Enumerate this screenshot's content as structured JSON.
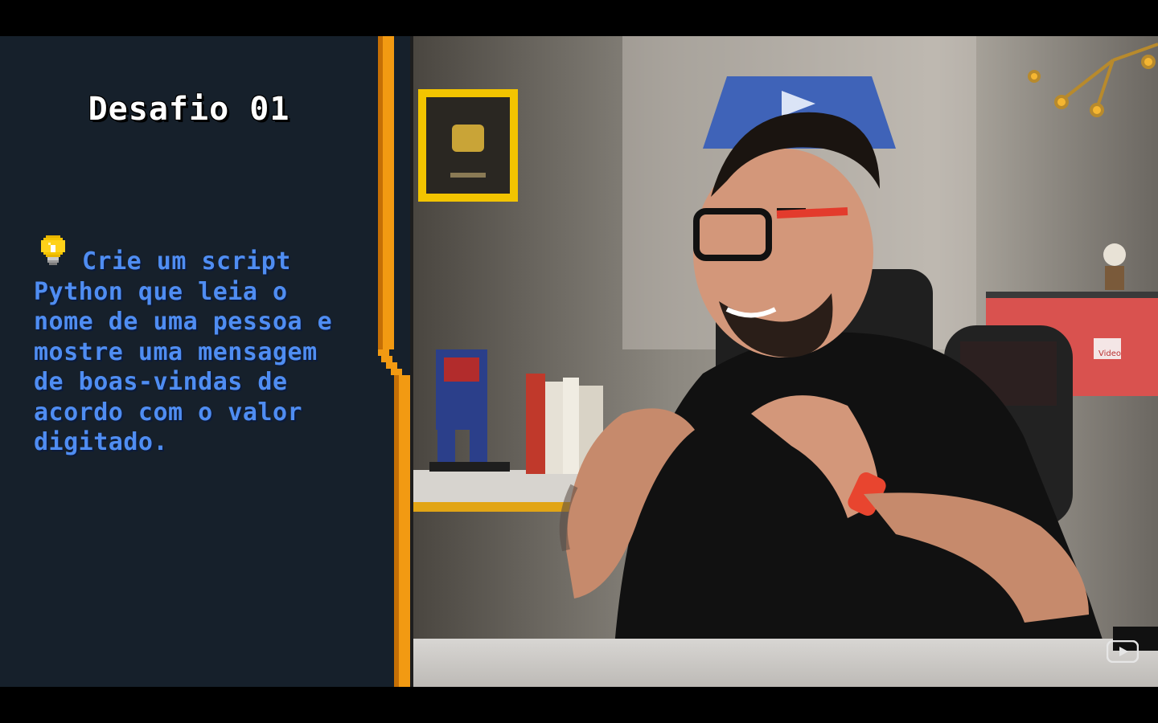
{
  "challenge": {
    "title": "Desafio 01",
    "icon": "lightbulb-icon",
    "text": "Crie um script Python que leia o nome de uma pessoa e mostre uma mensagem de boas-vindas de acordo com o valor digitado."
  },
  "scene": {
    "monitor_label": "Video"
  },
  "colors": {
    "panel_bg": "#16202b",
    "accent_orange": "#f29a12",
    "text_blue": "#4f8df2",
    "title_white": "#ffffff"
  },
  "player": {
    "logo_icon": "youtube-logo-icon"
  }
}
